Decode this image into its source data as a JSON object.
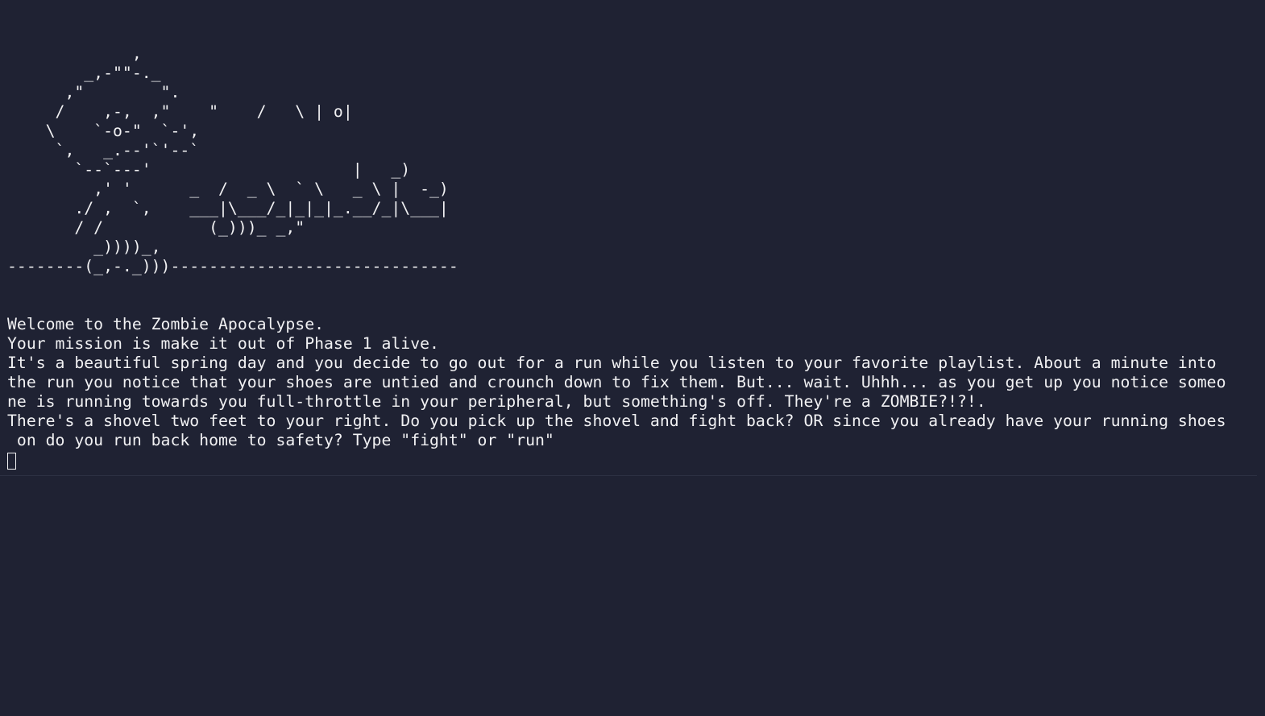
{
  "terminal": {
    "ascii_art": [
      "             ,",
      "        _,-\"\"-._",
      "      ,\"        \".",
      "     /    ,-,  ,\"    \"    /   \\ | o|",
      "    \\    `-o-\"  `-',",
      "     `,   _.--'`'--`",
      "       `--`---'                     |   _)",
      "         ,' '      _  /  _ \\  ` \\   _ \\ |  -_)",
      "       ./ ,  `,    ___|\\___/_|_|_|_.__/_|\\___|",
      "       / /           (_)))_ _,\"",
      "         _))))_,",
      "--------(_,-._)))------------------------------"
    ],
    "messages": [
      "Welcome to the Zombie Apocalypse.",
      "Your mission is make it out of Phase 1 alive.",
      "It's a beautiful spring day and you decide to go out for a run while you listen to your favorite playlist. About a minute into",
      "the run you notice that your shoes are untied and crounch down to fix them. But... wait. Uhhh... as you get up you notice someo",
      "ne is running towards you full-throttle in your peripheral, but something's off. They're a ZOMBIE?!?!.",
      "There's a shovel two feet to your right. Do you pick up the shovel and fight back? OR since you already have your running shoes",
      " on do you run back home to safety? Type \"fight\" or \"run\""
    ],
    "input": {
      "value": ""
    },
    "colors": {
      "background": "#1f2233",
      "foreground": "#f1f1f3"
    }
  }
}
